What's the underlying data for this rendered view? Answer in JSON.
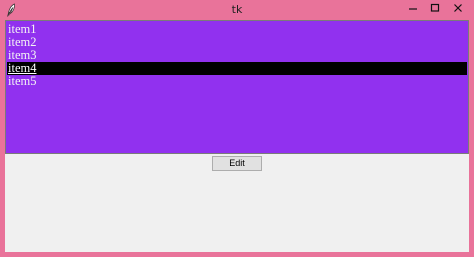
{
  "window": {
    "title": "tk"
  },
  "listbox": {
    "items": [
      {
        "label": "item1"
      },
      {
        "label": "item2"
      },
      {
        "label": "item3"
      },
      {
        "label": "item4"
      },
      {
        "label": "item5"
      }
    ],
    "selected_index": 3,
    "background_color": "#9131ef",
    "selection_color": "#000000"
  },
  "buttons": {
    "edit_label": "Edit"
  },
  "icons": {
    "app": "feather-icon",
    "minimize": "minimize-icon",
    "maximize": "maximize-icon",
    "close": "close-icon"
  },
  "colors": {
    "frame": "#e9739a",
    "client_background": "#f0f0f0"
  }
}
